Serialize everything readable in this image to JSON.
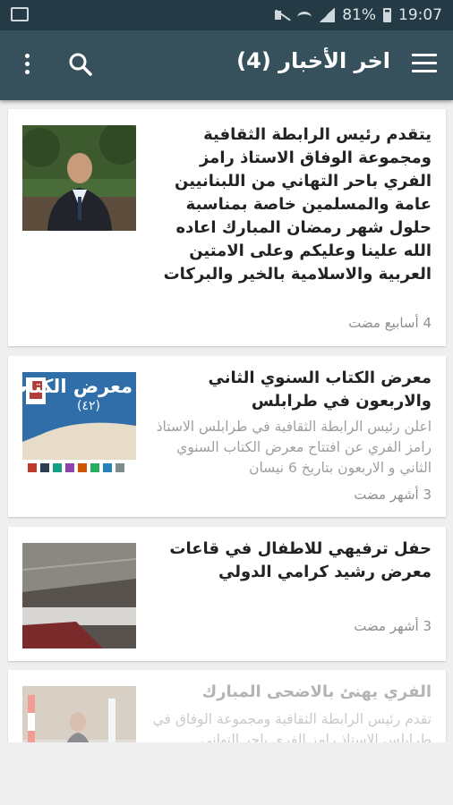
{
  "status_bar": {
    "battery": "81%",
    "time": "19:07"
  },
  "toolbar": {
    "title": "اخر الأخبار (4)",
    "menu_icon": "hamburger-menu-icon",
    "search_icon": "search-icon",
    "overflow_icon": "more-vert-icon",
    "background": "#37515c"
  },
  "articles": [
    {
      "title": "يتقدم رئيس الرابطة الثقافية ومجموعة الوفاق الاستاذ رامز الفري باحر التهاني من اللبنانيين عامة والمسلمين خاصة بمناسبة حلول شهر رمضان المبارك اعاده الله علينا وعليكم وعلى الامتين العربية والاسلامية بالخير والبركات",
      "excerpt": "",
      "time": "4 أسابيع مضت"
    },
    {
      "title": "معرض الكتاب السنوي الثاني والاربعون في طرابلس",
      "excerpt": "اعلن رئيس الرابطة الثقافية في طرابلس الاستاذ رامز الفري عن افتتاح معرض الكتاب السنوي الثاني و الاربعون بتاريخ 6 نيسان",
      "time": "3 أشهر مضت",
      "thumb_text": "معرض الكتاب",
      "thumb_sub": "(٤٢)"
    },
    {
      "title": "حفل ترفيهي للاطفال في قاعات معرض رشيد كرامي الدولي",
      "excerpt": "",
      "time": "3 أشهر مضت"
    },
    {
      "title": "الفري يهنئ بالاضحى المبارك",
      "excerpt": "تقدم رئيس الرابطة الثقافية ومجموعة الوفاق في طرابلس الاستاذ رامز الفري باحر التهاني",
      "time": ""
    }
  ]
}
